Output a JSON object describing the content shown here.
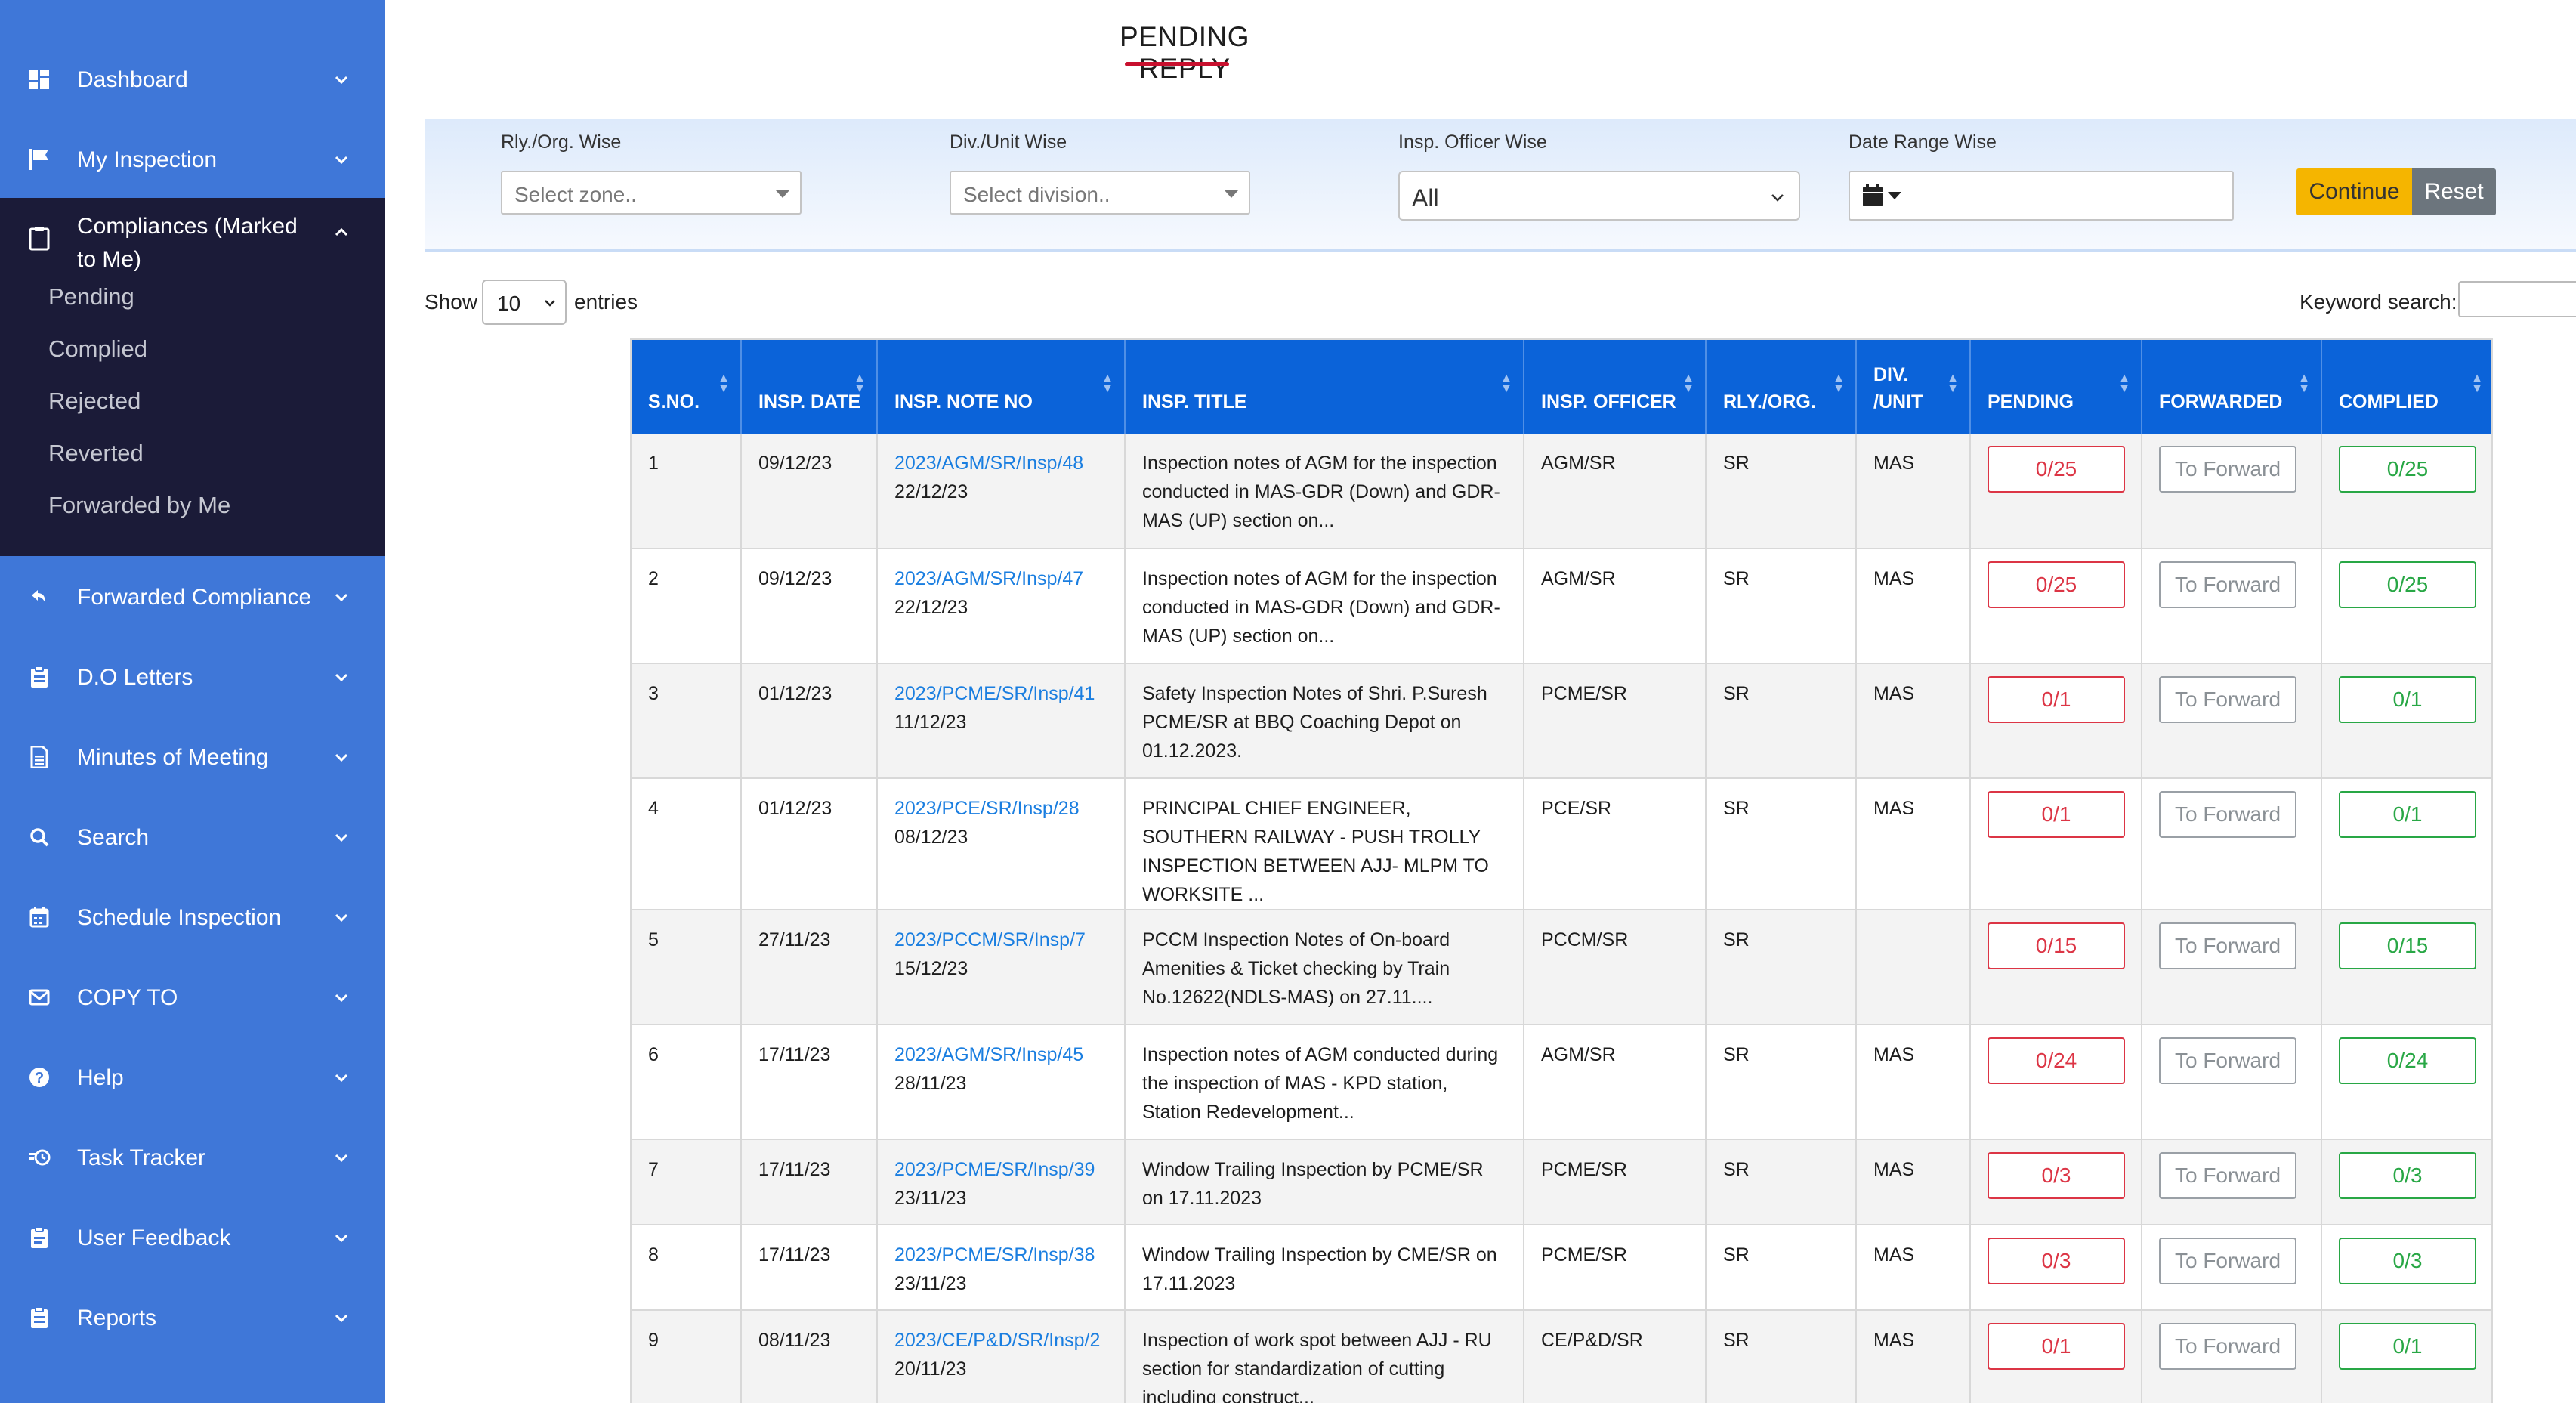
{
  "sidebar": {
    "items_top": [
      {
        "label": "Dashboard",
        "icon": "dashboard-icon"
      },
      {
        "label": "My Inspection",
        "icon": "flag-icon"
      }
    ],
    "active_group": {
      "label": "Compliances (Marked to Me)",
      "icon": "clipboard-icon",
      "sub_items": [
        "Pending",
        "Complied",
        "Rejected",
        "Reverted",
        "Forwarded by Me"
      ]
    },
    "items_bottom": [
      {
        "label": "Forwarded Compliance",
        "icon": "reply-icon"
      },
      {
        "label": "D.O Letters",
        "icon": "clipboard-list-icon"
      },
      {
        "label": "Minutes of Meeting",
        "icon": "document-icon"
      },
      {
        "label": "Search",
        "icon": "search-icon"
      },
      {
        "label": "Schedule Inspection",
        "icon": "calendar-icon"
      },
      {
        "label": "COPY TO",
        "icon": "envelope-icon"
      },
      {
        "label": "Help",
        "icon": "help-icon"
      },
      {
        "label": "Task Tracker",
        "icon": "task-tracker-icon"
      },
      {
        "label": "User Feedback",
        "icon": "feedback-icon"
      },
      {
        "label": "Reports",
        "icon": "reports-icon"
      }
    ]
  },
  "page": {
    "title": "PENDING REPLY"
  },
  "filters": {
    "zone": {
      "label": "Rly./Org. Wise",
      "placeholder": "Select zone.."
    },
    "division": {
      "label": "Div./Unit Wise",
      "placeholder": "Select division.."
    },
    "officer": {
      "label": "Insp. Officer Wise",
      "value": "All"
    },
    "date_range": {
      "label": "Date Range Wise",
      "value": ""
    },
    "continue_label": "Continue",
    "reset_label": "Reset"
  },
  "table_controls": {
    "show_label": "Show",
    "entries_value": "10",
    "entries_label": "entries",
    "keyword_label": "Keyword search:"
  },
  "table": {
    "headers": [
      "S.NO.",
      "INSP. DATE",
      "INSP. NOTE NO",
      "INSP. TITLE",
      "INSP. OFFICER",
      "RLY./ORG.",
      "DIV. /UNIT",
      "PENDING",
      "FORWARDED",
      "COMPLIED"
    ],
    "rows": [
      {
        "sno": "1",
        "date": "09/12/23",
        "note_no": "2023/AGM/SR/Insp/48",
        "note_date": "22/12/23",
        "title": "Inspection notes of AGM for the inspection conducted in MAS-GDR (Down) and GDR-MAS (UP) section on...",
        "officer": "AGM/SR",
        "rly": "SR",
        "div": "MAS",
        "pending": "0/25",
        "forwarded": "To Forward",
        "complied": "0/25"
      },
      {
        "sno": "2",
        "date": "09/12/23",
        "note_no": "2023/AGM/SR/Insp/47",
        "note_date": "22/12/23",
        "title": "Inspection notes of AGM for the inspection conducted in MAS-GDR (Down) and GDR-MAS (UP) section on...",
        "officer": "AGM/SR",
        "rly": "SR",
        "div": "MAS",
        "pending": "0/25",
        "forwarded": "To Forward",
        "complied": "0/25"
      },
      {
        "sno": "3",
        "date": "01/12/23",
        "note_no": "2023/PCME/SR/Insp/41",
        "note_date": "11/12/23",
        "title": "Safety Inspection Notes of Shri. P.Suresh PCME/SR at BBQ Coaching Depot on 01.12.2023.",
        "officer": "PCME/SR",
        "rly": "SR",
        "div": "MAS",
        "pending": "0/1",
        "forwarded": "To Forward",
        "complied": "0/1"
      },
      {
        "sno": "4",
        "date": "01/12/23",
        "note_no": "2023/PCE/SR/Insp/28",
        "note_date": "08/12/23",
        "title": "PRINCIPAL CHIEF ENGINEER, SOUTHERN RAILWAY - PUSH TROLLY INSPECTION BETWEEN AJJ- MLPM TO WORKSITE ...",
        "officer": "PCE/SR",
        "rly": "SR",
        "div": "MAS",
        "pending": "0/1",
        "forwarded": "To Forward",
        "complied": "0/1"
      },
      {
        "sno": "5",
        "date": "27/11/23",
        "note_no": "2023/PCCM/SR/Insp/7",
        "note_date": "15/12/23",
        "title": "PCCM Inspection Notes of On-board Amenities & Ticket checking by Train No.12622(NDLS-MAS) on 27.11....",
        "officer": "PCCM/SR",
        "rly": "SR",
        "div": "",
        "pending": "0/15",
        "forwarded": "To Forward",
        "complied": "0/15"
      },
      {
        "sno": "6",
        "date": "17/11/23",
        "note_no": "2023/AGM/SR/Insp/45",
        "note_date": "28/11/23",
        "title": "Inspection notes of AGM conducted during the inspection of MAS - KPD station, Station Redevelopment...",
        "officer": "AGM/SR",
        "rly": "SR",
        "div": "MAS",
        "pending": "0/24",
        "forwarded": "To Forward",
        "complied": "0/24"
      },
      {
        "sno": "7",
        "date": "17/11/23",
        "note_no": "2023/PCME/SR/Insp/39",
        "note_date": "23/11/23",
        "title": "Window Trailing Inspection by PCME/SR on 17.11.2023",
        "officer": "PCME/SR",
        "rly": "SR",
        "div": "MAS",
        "pending": "0/3",
        "forwarded": "To Forward",
        "complied": "0/3"
      },
      {
        "sno": "8",
        "date": "17/11/23",
        "note_no": "2023/PCME/SR/Insp/38",
        "note_date": "23/11/23",
        "title": "Window Trailing Inspection by CME/SR on 17.11.2023",
        "officer": "PCME/SR",
        "rly": "SR",
        "div": "MAS",
        "pending": "0/3",
        "forwarded": "To Forward",
        "complied": "0/3"
      },
      {
        "sno": "9",
        "date": "08/11/23",
        "note_no": "2023/CE/P&D/SR/Insp/2",
        "note_date": "20/11/23",
        "title": "Inspection of work spot between AJJ - RU section for standardization of cutting including construct...",
        "officer": "CE/P&D/SR",
        "rly": "SR",
        "div": "MAS",
        "pending": "0/1",
        "forwarded": "To Forward",
        "complied": "0/1"
      }
    ]
  },
  "colors": {
    "sidebar": "#3f77d8",
    "sidebar_active": "#1b1b38",
    "header": "#0b63d9",
    "pending": "#dc3545",
    "complied": "#28a745",
    "continue": "#f5b500",
    "reset": "#6c757d",
    "accent": "#c8102e"
  }
}
